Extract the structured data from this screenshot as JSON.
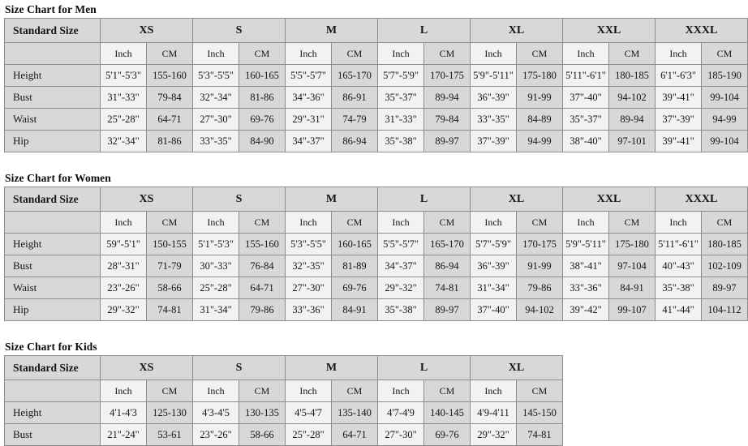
{
  "charts": [
    {
      "title": "Size Chart for Men",
      "standard_size_label": "Standard Size",
      "sizes": [
        "XS",
        "S",
        "M",
        "L",
        "XL",
        "XXL",
        "XXXL"
      ],
      "units": [
        "Inch",
        "CM"
      ],
      "rows": [
        {
          "label": "Height",
          "values": [
            "5'1\"-5'3\"",
            "155-160",
            "5'3\"-5'5\"",
            "160-165",
            "5'5\"-5'7\"",
            "165-170",
            "5'7\"-5'9\"",
            "170-175",
            "5'9\"-5'11\"",
            "175-180",
            "5'11\"-6'1\"",
            "180-185",
            "6'1\"-6'3\"",
            "185-190"
          ]
        },
        {
          "label": "Bust",
          "values": [
            "31\"-33\"",
            "79-84",
            "32\"-34\"",
            "81-86",
            "34\"-36\"",
            "86-91",
            "35\"-37\"",
            "89-94",
            "36\"-39\"",
            "91-99",
            "37\"-40\"",
            "94-102",
            "39\"-41\"",
            "99-104"
          ]
        },
        {
          "label": "Waist",
          "values": [
            "25\"-28\"",
            "64-71",
            "27\"-30\"",
            "69-76",
            "29\"-31\"",
            "74-79",
            "31\"-33\"",
            "79-84",
            "33\"-35\"",
            "84-89",
            "35\"-37\"",
            "89-94",
            "37\"-39\"",
            "94-99"
          ]
        },
        {
          "label": "Hip",
          "values": [
            "32\"-34\"",
            "81-86",
            "33\"-35\"",
            "84-90",
            "34\"-37\"",
            "86-94",
            "35\"-38\"",
            "89-97",
            "37\"-39\"",
            "94-99",
            "38\"-40\"",
            "97-101",
            "39\"-41\"",
            "99-104"
          ]
        }
      ]
    },
    {
      "title": "Size Chart for Women",
      "standard_size_label": "Standard Size",
      "sizes": [
        "XS",
        "S",
        "M",
        "L",
        "XL",
        "XXL",
        "XXXL"
      ],
      "units": [
        "Inch",
        "CM"
      ],
      "rows": [
        {
          "label": "Height",
          "values": [
            "59\"-5'1\"",
            "150-155",
            "5'1\"-5'3\"",
            "155-160",
            "5'3\"-5'5\"",
            "160-165",
            "5'5\"-5'7\"",
            "165-170",
            "5'7\"-5'9\"",
            "170-175",
            "5'9\"-5'11\"",
            "175-180",
            "5'11\"-6'1\"",
            "180-185"
          ]
        },
        {
          "label": "Bust",
          "values": [
            "28\"-31\"",
            "71-79",
            "30\"-33\"",
            "76-84",
            "32\"-35\"",
            "81-89",
            "34\"-37\"",
            "86-94",
            "36\"-39\"",
            "91-99",
            "38\"-41\"",
            "97-104",
            "40\"-43\"",
            "102-109"
          ]
        },
        {
          "label": "Waist",
          "values": [
            "23\"-26\"",
            "58-66",
            "25\"-28\"",
            "64-71",
            "27\"-30\"",
            "69-76",
            "29\"-32\"",
            "74-81",
            "31\"-34\"",
            "79-86",
            "33\"-36\"",
            "84-91",
            "35\"-38\"",
            "89-97"
          ]
        },
        {
          "label": "Hip",
          "values": [
            "29\"-32\"",
            "74-81",
            "31\"-34\"",
            "79-86",
            "33\"-36\"",
            "84-91",
            "35\"-38\"",
            "89-97",
            "37\"-40\"",
            "94-102",
            "39\"-42\"",
            "99-107",
            "41\"-44\"",
            "104-112"
          ]
        }
      ]
    },
    {
      "title": "Size Chart for Kids",
      "standard_size_label": "Standard Size",
      "sizes": [
        "XS",
        "S",
        "M",
        "L",
        "XL"
      ],
      "units": [
        "Inch",
        "CM"
      ],
      "rows": [
        {
          "label": "Height",
          "values": [
            "4'1-4'3",
            "125-130",
            "4'3-4'5",
            "130-135",
            "4'5-4'7",
            "135-140",
            "4'7-4'9",
            "140-145",
            "4'9-4'11",
            "145-150"
          ]
        },
        {
          "label": "Bust",
          "values": [
            "21\"-24\"",
            "53-61",
            "23\"-26\"",
            "58-66",
            "25\"-28\"",
            "64-71",
            "27\"-30\"",
            "69-76",
            "29\"-32\"",
            "74-81"
          ]
        }
      ]
    }
  ]
}
